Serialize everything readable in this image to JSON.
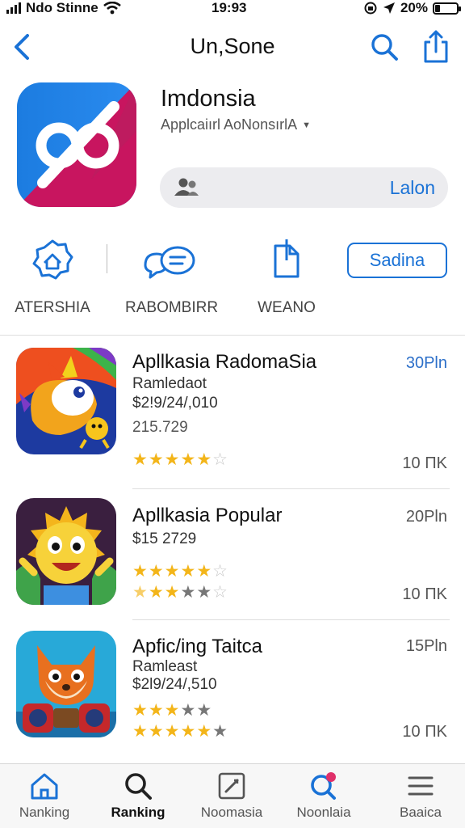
{
  "status_bar": {
    "carrier": "Ndo Stinne",
    "time": "19:93",
    "battery": "20%",
    "battery_level": 0.2
  },
  "nav": {
    "title": "Un,Sone"
  },
  "app": {
    "name": "Imdonsia",
    "subtitle": "Applcaiırl AoNonsırlA",
    "get_label": "Lalon"
  },
  "actions": [
    {
      "label": "ATERSHIA",
      "icon": "home-badge-icon"
    },
    {
      "label": "RABOMBIRR",
      "icon": "chat-bubbles-icon"
    },
    {
      "label": "WEANO",
      "icon": "document-icon"
    }
  ],
  "sadina_button": "Sadina",
  "list": [
    {
      "title": "Apllkasia RadomaSia",
      "line1": "Ramledaot",
      "line2": "$2!9/24/,010",
      "line3": "215.729",
      "price": "30Pln",
      "count": "10 ΠK",
      "rating_row1": [
        "on",
        "on",
        "on",
        "on",
        "on",
        "off"
      ],
      "rating_row2": []
    },
    {
      "title": "Apllkasia Popular",
      "line1": "$15 2729",
      "line2": "",
      "line3": "",
      "price": "20Pln",
      "count": "10 ΠK",
      "rating_row1": [
        "on",
        "on",
        "on",
        "on",
        "on",
        "off"
      ],
      "rating_row2": [
        "half",
        "on",
        "on",
        "gray",
        "gray",
        "off"
      ]
    },
    {
      "title": "Apfic/ing Taitca",
      "line1": "Ramleast",
      "line2": "$2l9/24/,510",
      "line3": "",
      "price": "15Pln",
      "count": "10 ΠK",
      "rating_row1": [
        "on",
        "on",
        "on",
        "gray",
        "gray"
      ],
      "rating_row2": [
        "on",
        "on",
        "on",
        "on",
        "on",
        "gray"
      ]
    }
  ],
  "tabs": [
    {
      "label": "Nanking",
      "icon": "house-icon",
      "active": false
    },
    {
      "label": "Ranking",
      "icon": "search-icon",
      "active": true
    },
    {
      "label": "Noomasia",
      "icon": "edit-square-icon",
      "active": false
    },
    {
      "label": "Noonlaia",
      "icon": "search-notification-icon",
      "active": false
    },
    {
      "label": "Baaica",
      "icon": "menu-lines-icon",
      "active": false
    }
  ],
  "colors": {
    "accent": "#1a72d6",
    "star": "#f3b519",
    "pill_bg": "#ececef"
  }
}
